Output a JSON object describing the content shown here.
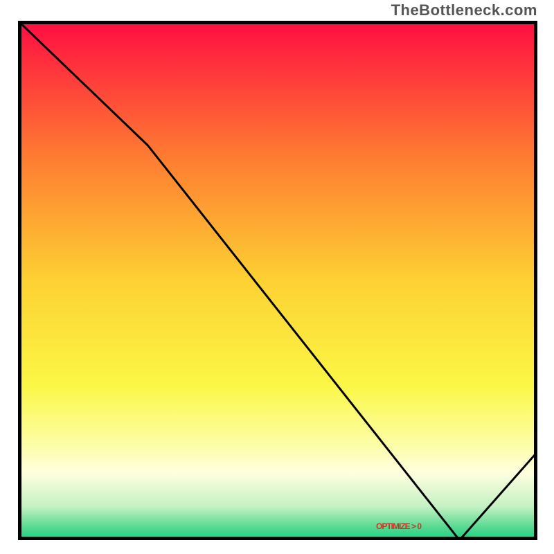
{
  "watermark": "TheBottleneck.com",
  "marker_label": "OPTIMIZE > 0",
  "chart_data": {
    "type": "line",
    "title": "",
    "xlabel": "",
    "ylabel": "",
    "xlim": [
      0,
      100
    ],
    "ylim": [
      0,
      100
    ],
    "grid": false,
    "series": [
      {
        "name": "curve",
        "x": [
          0,
          25,
          85,
          100
        ],
        "y": [
          100,
          76,
          0,
          17
        ],
        "color": "#000000"
      }
    ],
    "gradient_stops": [
      {
        "offset": 0.0,
        "color": "#ff0d42"
      },
      {
        "offset": 0.25,
        "color": "#fe7732"
      },
      {
        "offset": 0.5,
        "color": "#fdd133"
      },
      {
        "offset": 0.7,
        "color": "#fbf745"
      },
      {
        "offset": 0.82,
        "color": "#fcfeaa"
      },
      {
        "offset": 0.87,
        "color": "#ffffdf"
      },
      {
        "offset": 0.935,
        "color": "#c5f1c3"
      },
      {
        "offset": 0.975,
        "color": "#57d991"
      },
      {
        "offset": 1.0,
        "color": "#19cf86"
      }
    ],
    "marker": {
      "x_pct": 78,
      "y_pct": 97.5
    }
  },
  "colors": {
    "border": "#000000",
    "watermark": "#555555",
    "marker_text": "#e80000"
  }
}
